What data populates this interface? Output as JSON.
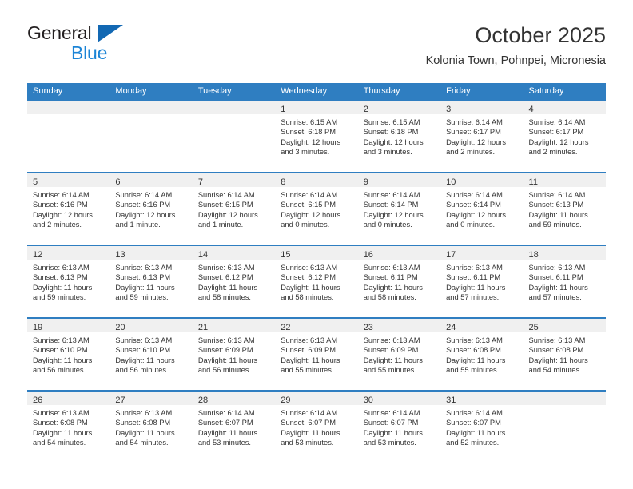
{
  "brand": {
    "line1": "General",
    "line2": "Blue",
    "triangle_icon": "blue-triangle-icon",
    "accent_color": "#1b84d6"
  },
  "header": {
    "title": "October 2025",
    "subtitle": "Kolonia Town, Pohnpei, Micronesia"
  },
  "theme": {
    "header_blue": "#2f7ec1",
    "daynum_gray": "#f0f0f0",
    "text": "#333333"
  },
  "weekdays": [
    "Sunday",
    "Monday",
    "Tuesday",
    "Wednesday",
    "Thursday",
    "Friday",
    "Saturday"
  ],
  "weeks": [
    [
      {
        "num": "",
        "lines": []
      },
      {
        "num": "",
        "lines": []
      },
      {
        "num": "",
        "lines": []
      },
      {
        "num": "1",
        "lines": [
          "Sunrise: 6:15 AM",
          "Sunset: 6:18 PM",
          "Daylight: 12 hours",
          "and 3 minutes."
        ]
      },
      {
        "num": "2",
        "lines": [
          "Sunrise: 6:15 AM",
          "Sunset: 6:18 PM",
          "Daylight: 12 hours",
          "and 3 minutes."
        ]
      },
      {
        "num": "3",
        "lines": [
          "Sunrise: 6:14 AM",
          "Sunset: 6:17 PM",
          "Daylight: 12 hours",
          "and 2 minutes."
        ]
      },
      {
        "num": "4",
        "lines": [
          "Sunrise: 6:14 AM",
          "Sunset: 6:17 PM",
          "Daylight: 12 hours",
          "and 2 minutes."
        ]
      }
    ],
    [
      {
        "num": "5",
        "lines": [
          "Sunrise: 6:14 AM",
          "Sunset: 6:16 PM",
          "Daylight: 12 hours",
          "and 2 minutes."
        ]
      },
      {
        "num": "6",
        "lines": [
          "Sunrise: 6:14 AM",
          "Sunset: 6:16 PM",
          "Daylight: 12 hours",
          "and 1 minute."
        ]
      },
      {
        "num": "7",
        "lines": [
          "Sunrise: 6:14 AM",
          "Sunset: 6:15 PM",
          "Daylight: 12 hours",
          "and 1 minute."
        ]
      },
      {
        "num": "8",
        "lines": [
          "Sunrise: 6:14 AM",
          "Sunset: 6:15 PM",
          "Daylight: 12 hours",
          "and 0 minutes."
        ]
      },
      {
        "num": "9",
        "lines": [
          "Sunrise: 6:14 AM",
          "Sunset: 6:14 PM",
          "Daylight: 12 hours",
          "and 0 minutes."
        ]
      },
      {
        "num": "10",
        "lines": [
          "Sunrise: 6:14 AM",
          "Sunset: 6:14 PM",
          "Daylight: 12 hours",
          "and 0 minutes."
        ]
      },
      {
        "num": "11",
        "lines": [
          "Sunrise: 6:14 AM",
          "Sunset: 6:13 PM",
          "Daylight: 11 hours",
          "and 59 minutes."
        ]
      }
    ],
    [
      {
        "num": "12",
        "lines": [
          "Sunrise: 6:13 AM",
          "Sunset: 6:13 PM",
          "Daylight: 11 hours",
          "and 59 minutes."
        ]
      },
      {
        "num": "13",
        "lines": [
          "Sunrise: 6:13 AM",
          "Sunset: 6:13 PM",
          "Daylight: 11 hours",
          "and 59 minutes."
        ]
      },
      {
        "num": "14",
        "lines": [
          "Sunrise: 6:13 AM",
          "Sunset: 6:12 PM",
          "Daylight: 11 hours",
          "and 58 minutes."
        ]
      },
      {
        "num": "15",
        "lines": [
          "Sunrise: 6:13 AM",
          "Sunset: 6:12 PM",
          "Daylight: 11 hours",
          "and 58 minutes."
        ]
      },
      {
        "num": "16",
        "lines": [
          "Sunrise: 6:13 AM",
          "Sunset: 6:11 PM",
          "Daylight: 11 hours",
          "and 58 minutes."
        ]
      },
      {
        "num": "17",
        "lines": [
          "Sunrise: 6:13 AM",
          "Sunset: 6:11 PM",
          "Daylight: 11 hours",
          "and 57 minutes."
        ]
      },
      {
        "num": "18",
        "lines": [
          "Sunrise: 6:13 AM",
          "Sunset: 6:11 PM",
          "Daylight: 11 hours",
          "and 57 minutes."
        ]
      }
    ],
    [
      {
        "num": "19",
        "lines": [
          "Sunrise: 6:13 AM",
          "Sunset: 6:10 PM",
          "Daylight: 11 hours",
          "and 56 minutes."
        ]
      },
      {
        "num": "20",
        "lines": [
          "Sunrise: 6:13 AM",
          "Sunset: 6:10 PM",
          "Daylight: 11 hours",
          "and 56 minutes."
        ]
      },
      {
        "num": "21",
        "lines": [
          "Sunrise: 6:13 AM",
          "Sunset: 6:09 PM",
          "Daylight: 11 hours",
          "and 56 minutes."
        ]
      },
      {
        "num": "22",
        "lines": [
          "Sunrise: 6:13 AM",
          "Sunset: 6:09 PM",
          "Daylight: 11 hours",
          "and 55 minutes."
        ]
      },
      {
        "num": "23",
        "lines": [
          "Sunrise: 6:13 AM",
          "Sunset: 6:09 PM",
          "Daylight: 11 hours",
          "and 55 minutes."
        ]
      },
      {
        "num": "24",
        "lines": [
          "Sunrise: 6:13 AM",
          "Sunset: 6:08 PM",
          "Daylight: 11 hours",
          "and 55 minutes."
        ]
      },
      {
        "num": "25",
        "lines": [
          "Sunrise: 6:13 AM",
          "Sunset: 6:08 PM",
          "Daylight: 11 hours",
          "and 54 minutes."
        ]
      }
    ],
    [
      {
        "num": "26",
        "lines": [
          "Sunrise: 6:13 AM",
          "Sunset: 6:08 PM",
          "Daylight: 11 hours",
          "and 54 minutes."
        ]
      },
      {
        "num": "27",
        "lines": [
          "Sunrise: 6:13 AM",
          "Sunset: 6:08 PM",
          "Daylight: 11 hours",
          "and 54 minutes."
        ]
      },
      {
        "num": "28",
        "lines": [
          "Sunrise: 6:14 AM",
          "Sunset: 6:07 PM",
          "Daylight: 11 hours",
          "and 53 minutes."
        ]
      },
      {
        "num": "29",
        "lines": [
          "Sunrise: 6:14 AM",
          "Sunset: 6:07 PM",
          "Daylight: 11 hours",
          "and 53 minutes."
        ]
      },
      {
        "num": "30",
        "lines": [
          "Sunrise: 6:14 AM",
          "Sunset: 6:07 PM",
          "Daylight: 11 hours",
          "and 53 minutes."
        ]
      },
      {
        "num": "31",
        "lines": [
          "Sunrise: 6:14 AM",
          "Sunset: 6:07 PM",
          "Daylight: 11 hours",
          "and 52 minutes."
        ]
      },
      {
        "num": "",
        "lines": []
      }
    ]
  ]
}
